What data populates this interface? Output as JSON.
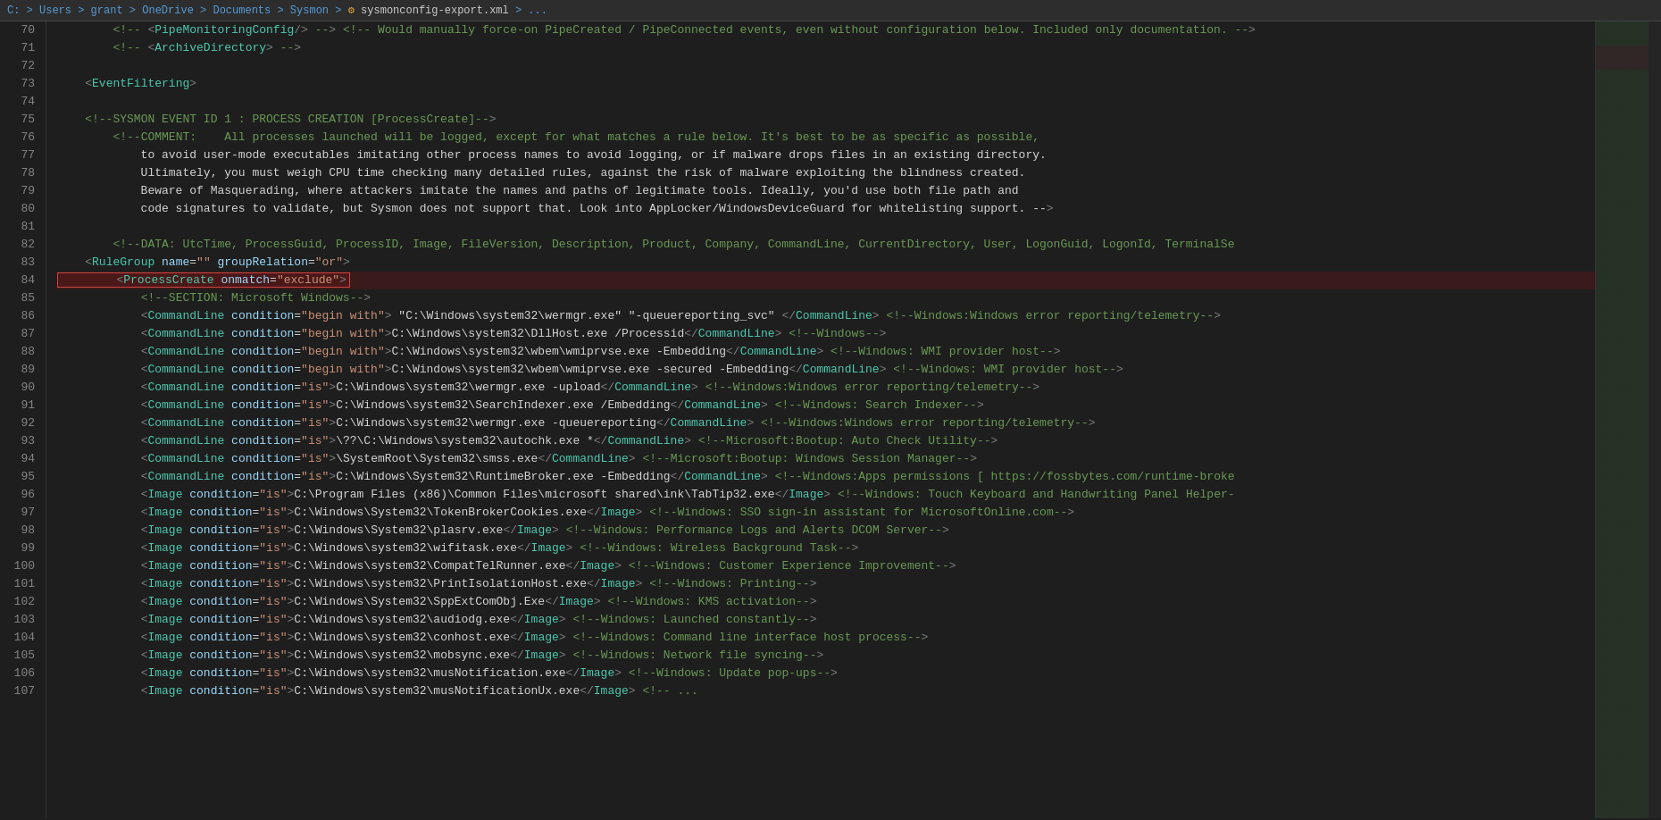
{
  "titleBar": {
    "path": "C: > Users > grant > OneDrive > Documents > Sysmon > ",
    "icon": "rss",
    "filename": "sysmonconfig-export.xml",
    "suffix": " > ..."
  },
  "lines": [
    {
      "num": 70,
      "content": "comment_pipe",
      "raw": "        <!-- <PipeMonitoringConfig/> --> <!-- Would manually force-on PipeCreated / PipeConnected events, even without configuration below. Included only documentation. -->"
    },
    {
      "num": 71,
      "content": "comment_archive",
      "raw": "        <!-- <ArchiveDirectory> -->"
    },
    {
      "num": 72,
      "content": "blank",
      "raw": ""
    },
    {
      "num": 73,
      "content": "event_filtering",
      "raw": "    <EventFiltering>"
    },
    {
      "num": 74,
      "content": "blank",
      "raw": ""
    },
    {
      "num": 75,
      "content": "comment_sysmon1",
      "raw": "    <!--SYSMON EVENT ID 1 : PROCESS CREATION [ProcessCreate]-->"
    },
    {
      "num": 76,
      "content": "comment_text1",
      "raw": "        <!--COMMENT:    All processes launched will be logged, except for what matches a rule below. It's best to be as specific as possible,"
    },
    {
      "num": 77,
      "content": "comment_text2",
      "raw": "            to avoid user-mode executables imitating other process names to avoid logging, or if malware drops files in an existing directory."
    },
    {
      "num": 78,
      "content": "comment_text3",
      "raw": "            Ultimately, you must weigh CPU time checking many detailed rules, against the risk of malware exploiting the blindness created."
    },
    {
      "num": 79,
      "content": "comment_text4",
      "raw": "            Beware of Masquerading, where attackers imitate the names and paths of legitimate tools. Ideally, you'd use both file path and"
    },
    {
      "num": 80,
      "content": "comment_text5",
      "raw": "            code signatures to validate, but Sysmon does not support that. Look into AppLocker/WindowsDeviceGuard for whitelisting support. -->"
    },
    {
      "num": 81,
      "content": "blank",
      "raw": ""
    },
    {
      "num": 82,
      "content": "comment_data",
      "raw": "        <!--DATA: UtcTime, ProcessGuid, ProcessID, Image, FileVersion, Description, Product, Company, CommandLine, CurrentDirectory, User, LogonGuid, LogonId, TerminalSe"
    },
    {
      "num": 83,
      "content": "rule_group",
      "raw": "    <RuleGroup name=\"\" groupRelation=\"or\">"
    },
    {
      "num": 84,
      "content": "process_create_highlight",
      "raw": "        <ProcessCreate onmatch=\"exclude\">"
    },
    {
      "num": 85,
      "content": "comment_ms_windows",
      "raw": "            <!--SECTION: Microsoft Windows-->"
    },
    {
      "num": 86,
      "content": "cmd86",
      "raw": "            <CommandLine condition=\"begin with\"> \"C:\\Windows\\system32\\wermgr.exe\" \"-queuereporting_svc\" </CommandLine> <!--Windows:Windows error reporting/telemetry-->"
    },
    {
      "num": 87,
      "content": "cmd87",
      "raw": "            <CommandLine condition=\"begin with\">C:\\Windows\\system32\\DllHost.exe /Processid</CommandLine> <!--Windows-->"
    },
    {
      "num": 88,
      "content": "cmd88",
      "raw": "            <CommandLine condition=\"begin with\">C:\\Windows\\system32\\wbem\\wmiprvse.exe -Embedding</CommandLine> <!--Windows: WMI provider host-->"
    },
    {
      "num": 89,
      "content": "cmd89",
      "raw": "            <CommandLine condition=\"begin with\">C:\\Windows\\system32\\wbem\\wmiprvse.exe -secured -Embedding</CommandLine> <!--Windows: WMI provider host-->"
    },
    {
      "num": 90,
      "content": "cmd90",
      "raw": "            <CommandLine condition=\"is\">C:\\Windows\\system32\\wermgr.exe -upload</CommandLine> <!--Windows:Windows error reporting/telemetry-->"
    },
    {
      "num": 91,
      "content": "cmd91",
      "raw": "            <CommandLine condition=\"is\">C:\\Windows\\system32\\SearchIndexer.exe /Embedding</CommandLine> <!--Windows: Search Indexer-->"
    },
    {
      "num": 92,
      "content": "cmd92",
      "raw": "            <CommandLine condition=\"is\">C:\\Windows\\system32\\wermgr.exe -queuereporting</CommandLine> <!--Windows:Windows error reporting/telemetry-->"
    },
    {
      "num": 93,
      "content": "cmd93",
      "raw": "            <CommandLine condition=\"is\">\\??\\C:\\Windows\\system32\\autochk.exe *</CommandLine> <!--Microsoft:Bootup: Auto Check Utility-->"
    },
    {
      "num": 94,
      "content": "cmd94",
      "raw": "            <CommandLine condition=\"is\">\\SystemRoot\\System32\\smss.exe</CommandLine> <!--Microsoft:Bootup: Windows Session Manager-->"
    },
    {
      "num": 95,
      "content": "cmd95",
      "raw": "            <CommandLine condition=\"is\">C:\\Windows\\System32\\RuntimeBroker.exe -Embedding</CommandLine> <!--Windows:Apps permissions [ https://fossbytes.com/runtime-broke"
    },
    {
      "num": 96,
      "content": "img96",
      "raw": "            <Image condition=\"is\">C:\\Program Files (x86)\\Common Files\\microsoft shared\\ink\\TabTip32.exe</Image> <!--Windows: Touch Keyboard and Handwriting Panel Helper-"
    },
    {
      "num": 97,
      "content": "img97",
      "raw": "            <Image condition=\"is\">C:\\Windows\\System32\\TokenBrokerCookies.exe</Image> <!--Windows: SSO sign-in assistant for MicrosoftOnline.com-->"
    },
    {
      "num": 98,
      "content": "img98",
      "raw": "            <Image condition=\"is\">C:\\Windows\\System32\\plasrv.exe</Image> <!--Windows: Performance Logs and Alerts DCOM Server-->"
    },
    {
      "num": 99,
      "content": "img99",
      "raw": "            <Image condition=\"is\">C:\\Windows\\system32\\wifitask.exe</Image> <!--Windows: Wireless Background Task-->"
    },
    {
      "num": 100,
      "content": "img100",
      "raw": "            <Image condition=\"is\">C:\\Windows\\system32\\CompatTelRunner.exe</Image> <!--Windows: Customer Experience Improvement-->"
    },
    {
      "num": 101,
      "content": "img101",
      "raw": "            <Image condition=\"is\">C:\\Windows\\system32\\PrintIsolationHost.exe</Image> <!--Windows: Printing-->"
    },
    {
      "num": 102,
      "content": "img102",
      "raw": "            <Image condition=\"is\">C:\\Windows\\System32\\SppExtComObj.Exe</Image> <!--Windows: KMS activation-->"
    },
    {
      "num": 103,
      "content": "img103",
      "raw": "            <Image condition=\"is\">C:\\Windows\\system32\\audiodg.exe</Image> <!--Windows: Launched constantly-->"
    },
    {
      "num": 104,
      "content": "img104",
      "raw": "            <Image condition=\"is\">C:\\Windows\\system32\\conhost.exe</Image> <!--Windows: Command line interface host process-->"
    },
    {
      "num": 105,
      "content": "img105",
      "raw": "            <Image condition=\"is\">C:\\Windows\\system32\\mobsync.exe</Image> <!--Windows: Network file syncing-->"
    },
    {
      "num": 106,
      "content": "img106",
      "raw": "            <Image condition=\"is\">C:\\Windows\\system32\\musNotification.exe</Image> <!--Windows: Update pop-ups-->"
    },
    {
      "num": 107,
      "content": "img107",
      "raw": "            <Image condition=\"is\">C:\\Windows\\system32\\musNotificationUx.exe</Image> <!-- ..."
    }
  ],
  "colors": {
    "background": "#1e1e1e",
    "lineNumber": "#858585",
    "comment": "#6a9955",
    "tag": "#4ec9b0",
    "attrName": "#9cdcfe",
    "attrValue": "#ce9178",
    "highlight": "#4a1818",
    "highlightBorder": "#e05050",
    "text": "#d4d4d4"
  }
}
